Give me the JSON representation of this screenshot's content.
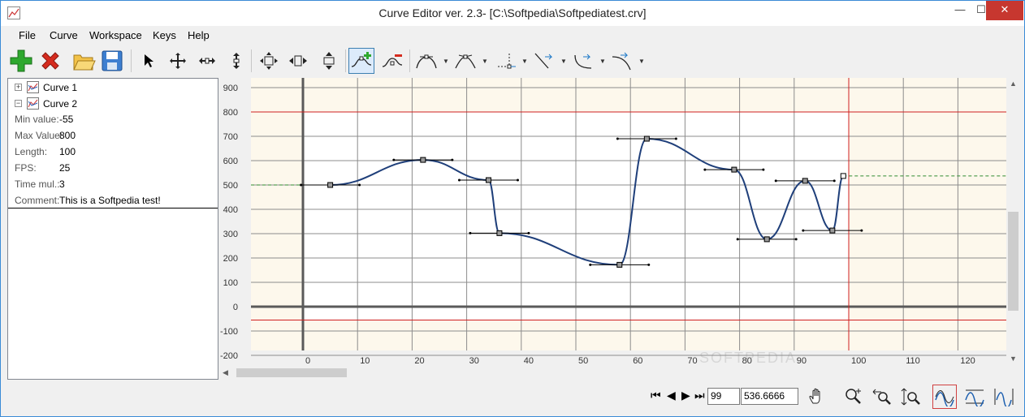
{
  "window": {
    "title": "Curve Editor ver. 2.3- [C:\\Softpedia\\Softpediatest.crv]",
    "minimize": "—",
    "maximize": "☐",
    "close": "✕"
  },
  "menu": [
    "File",
    "Curve",
    "Workspace",
    "Keys",
    "Help"
  ],
  "toolbar": {
    "icons": [
      "add-icon",
      "delete-icon",
      "open-folder-icon",
      "save-icon",
      "pointer-icon",
      "move-all-icon",
      "move-horizontal-icon",
      "move-vertical-icon",
      "scale-all-icon",
      "scale-horizontal-icon",
      "scale-vertical-icon",
      "add-key-icon",
      "remove-key-icon",
      "smooth-tangent-icon",
      "break-tangent-icon",
      "linear-tangent-icon",
      "in-tangent-icon",
      "out-tangent-icon",
      "both-tangent-icon"
    ]
  },
  "tree": {
    "curves": [
      {
        "expander": "+",
        "label": "Curve 1"
      },
      {
        "expander": "−",
        "label": "Curve 2"
      }
    ],
    "properties": [
      {
        "label": "Min value:",
        "value": "-55"
      },
      {
        "label": "Max Value:",
        "value": "800"
      },
      {
        "label": "Length:",
        "value": "100"
      },
      {
        "label": "FPS:",
        "value": "25"
      },
      {
        "label": "Time mul.:",
        "value": "3"
      },
      {
        "label": "Comment:",
        "value": "This is a Softpedia test!"
      }
    ]
  },
  "plot": {
    "y_ticks": [
      "900",
      "800",
      "700",
      "600",
      "500",
      "400",
      "300",
      "200",
      "100",
      "0",
      "-100",
      "-200"
    ],
    "x_ticks": [
      "0",
      "10",
      "20",
      "30",
      "40",
      "50",
      "60",
      "70",
      "80",
      "90",
      "100",
      "110",
      "120"
    ],
    "min_line": -55,
    "max_line": 800,
    "length": 100,
    "keys": [
      {
        "x": 5,
        "y": 500
      },
      {
        "x": 22,
        "y": 603
      },
      {
        "x": 34,
        "y": 520
      },
      {
        "x": 36,
        "y": 302
      },
      {
        "x": 58,
        "y": 172
      },
      {
        "x": 63,
        "y": 690
      },
      {
        "x": 79,
        "y": 563
      },
      {
        "x": 85,
        "y": 277
      },
      {
        "x": 92,
        "y": 517
      },
      {
        "x": 97,
        "y": 313
      },
      {
        "x": 99,
        "y": 537
      }
    ],
    "curve_color": "#1f3f7a",
    "grid_color": "#6e6e6e",
    "limit_color": "#d01f1f",
    "bg_outside": "#fdf8ec",
    "bg_inside": "#ffffff",
    "extrapolation_color": "#2f8a2f"
  },
  "bottom": {
    "nav": [
      "⏮",
      "◀",
      "▶",
      "⏭"
    ],
    "frame": "99",
    "value": "536.6666",
    "icons": [
      "pan-hand-icon",
      "zoom-icon",
      "zoom-horizontal-icon",
      "zoom-vertical-icon",
      "view-curves-icon",
      "view-fit-icon",
      "view-all-icon"
    ]
  },
  "watermark": "SOFTPEDIA"
}
